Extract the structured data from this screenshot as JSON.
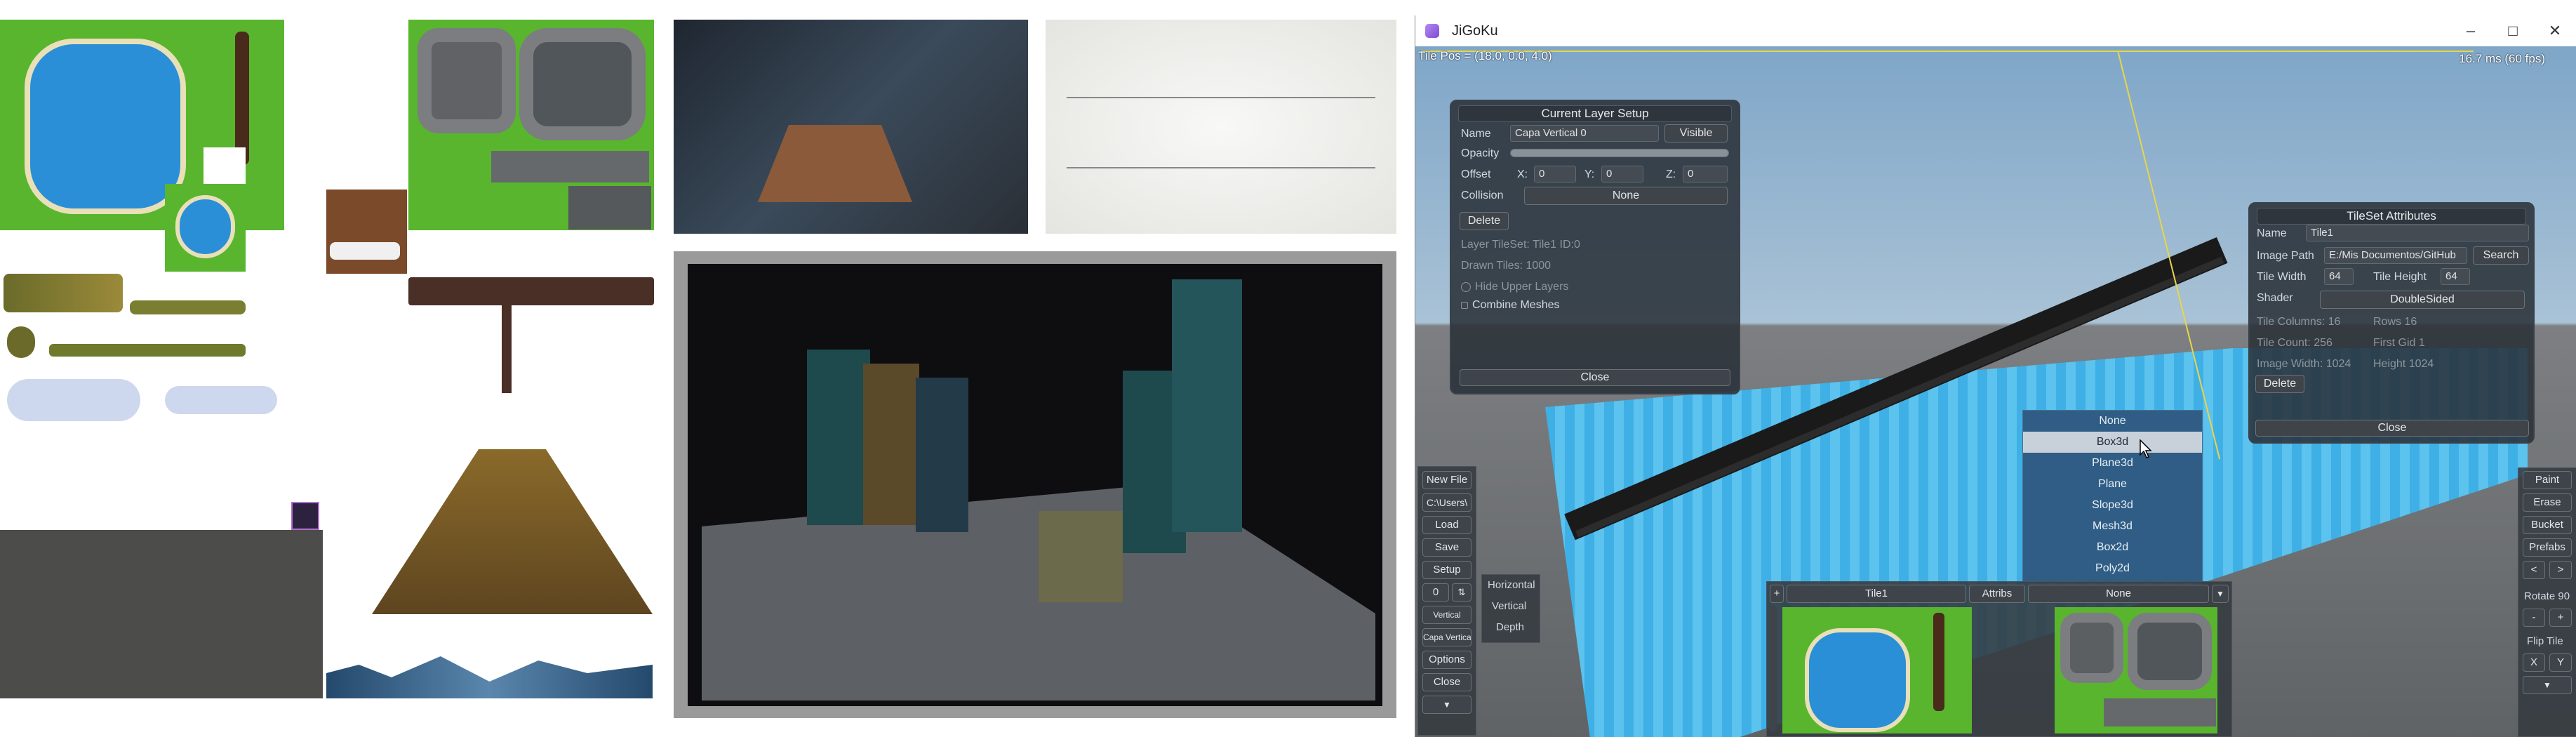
{
  "window": {
    "title": "JiGoKu",
    "minimize_glyph": "–",
    "maximize_glyph": "□",
    "close_glyph": "✕"
  },
  "hud": {
    "tile_pos": "Tile Pos = (18.0, 0.0, 4.0)",
    "frame_time": "16.7 ms (60 fps)"
  },
  "layer_setup": {
    "title": "Current Layer Setup",
    "name_label": "Name",
    "name_value": "Capa Vertical 0",
    "visible_button": "Visible",
    "opacity_label": "Opacity",
    "opacity_value": 1.0,
    "offset_label": "Offset",
    "x_label": "X:",
    "x_value": "0",
    "y_label": "Y:",
    "y_value": "0",
    "z_label": "Z:",
    "z_value": "0",
    "collision_label": "Collision",
    "collision_value": "None",
    "delete_button": "Delete",
    "layer_tileset": "Layer TileSet: Tile1 ID:0",
    "drawn_tiles": "Drawn Tiles: 1000",
    "hide_upper_layers": "Hide Upper Layers",
    "combine_meshes": "Combine Meshes",
    "close_button": "Close"
  },
  "tileset_attributes": {
    "title": "TileSet Attributes",
    "name_label": "Name",
    "name_value": "Tile1",
    "image_path_label": "Image Path",
    "image_path_value": "E:/Mis Documentos/GitHub",
    "search_button": "Search",
    "tile_width_label": "Tile Width",
    "tile_width_value": "64",
    "tile_height_label": "Tile Height",
    "tile_height_value": "64",
    "shader_label": "Shader",
    "shader_value": "DoubleSided",
    "tile_columns": "Tile Columns: 16",
    "rows": "Rows 16",
    "tile_count": "Tile Count: 256",
    "first_gid": "First Gid 1",
    "image_width": "Image Width: 1024",
    "image_height": "Height 1024",
    "delete_button": "Delete",
    "close_button": "Close"
  },
  "mesh_dropdown": {
    "items": [
      "None",
      "Box3d",
      "Plane3d",
      "Plane",
      "Slope3d",
      "Mesh3d",
      "Box2d",
      "Poly2d"
    ],
    "selected": "Box3d"
  },
  "left_toolbar": {
    "new_file": "New File",
    "path": "C:\\Users\\",
    "load": "Load",
    "save": "Save",
    "setup": "Setup",
    "layer_index": "0",
    "vertical": "Vertical",
    "layer_name": "Capa Vertica",
    "options": "Options",
    "close": "Close",
    "down_arrow": "▼"
  },
  "orientation_menu": {
    "items": [
      "Horizontal",
      "Vertical",
      "Depth"
    ]
  },
  "tileset_bar": {
    "plus": "+",
    "tileset_name": "Tile1",
    "attribs": "Attribs",
    "mesh_value": "None",
    "arrow": "▼"
  },
  "right_toolbar": {
    "paint": "Paint",
    "erase": "Erase",
    "bucket": "Bucket",
    "prefabs": "Prefabs",
    "prev": "<",
    "next": ">",
    "rotate": "Rotate 90",
    "minus": "-",
    "plus": "+",
    "flip_tile": "Flip Tile",
    "flip_x": "X",
    "flip_y": "Y",
    "down_arrow": "▼"
  },
  "colors": {
    "grass": "#59b52e",
    "water": "#2a8fd6",
    "panel_bg": "#282e36",
    "dropdown_bg": "#2f5d85",
    "dropdown_selected": "#c8d1da",
    "sky": "#a9c2d6"
  }
}
